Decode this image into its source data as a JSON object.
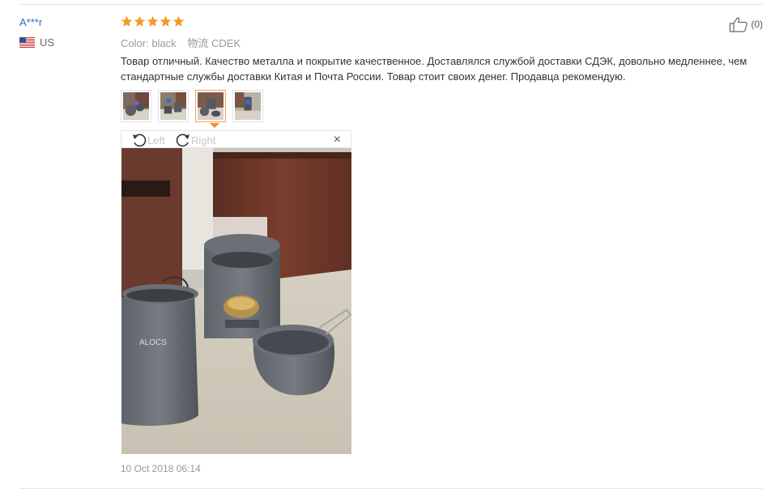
{
  "user": {
    "name": "A***r",
    "country": "US"
  },
  "rating": {
    "stars": 5,
    "max": 5
  },
  "meta": {
    "color_label": "Color:",
    "color_value": "black",
    "shipping_label": "物流",
    "shipping_value": "CDEK"
  },
  "like": {
    "count": "(0)"
  },
  "review": {
    "text": "Товар отличный. Качество металла и покрытие качественное. Доставлялся службой доставки СДЭК, довольно медленнее, чем стандартные службы доставки Китая и Почта России. Товар стоит своих денег. Продавца рекомендую."
  },
  "viewer": {
    "left_label": "Left",
    "right_label": "Right",
    "close_label": "×"
  },
  "date": "10 Oct 2018 06:14",
  "colors": {
    "link": "#2b6cc4",
    "star": "#f59a23",
    "active_border": "#f0a35e"
  },
  "photo": {
    "brand_text": "ALOCS"
  }
}
